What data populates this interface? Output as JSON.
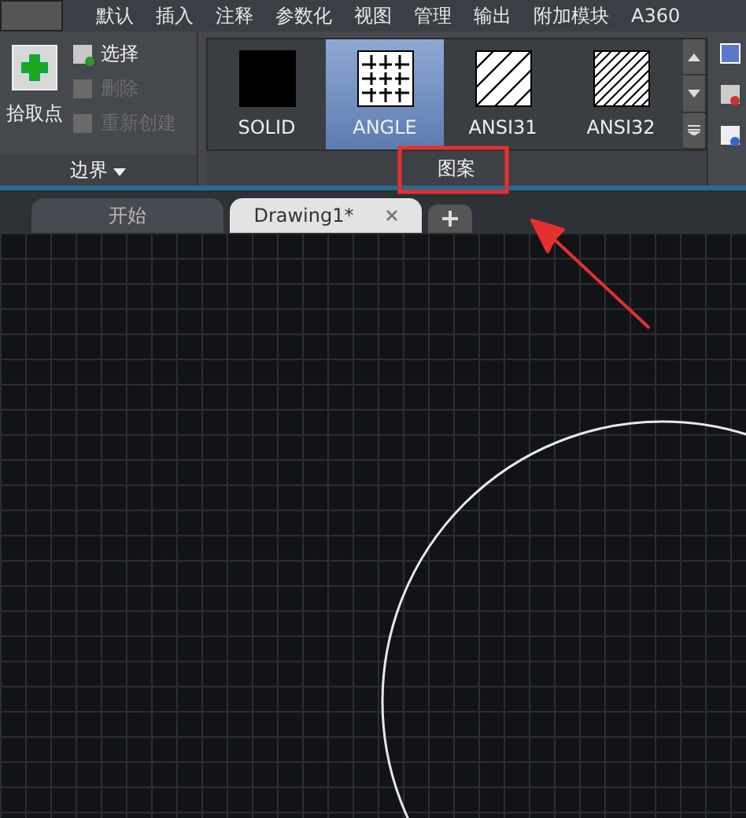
{
  "menu_tabs": [
    {
      "label": "默认",
      "selected": false
    },
    {
      "label": "插入",
      "selected": false
    },
    {
      "label": "注释",
      "selected": false
    },
    {
      "label": "参数化",
      "selected": false
    },
    {
      "label": "视图",
      "selected": false
    },
    {
      "label": "管理",
      "selected": false
    },
    {
      "label": "输出",
      "selected": false
    },
    {
      "label": "附加模块",
      "selected": false
    },
    {
      "label": "A360",
      "selected": false
    }
  ],
  "boundary_panel": {
    "pick_point": "拾取点",
    "items": [
      {
        "label": "选择",
        "disabled": false
      },
      {
        "label": "删除",
        "disabled": true
      },
      {
        "label": "重新创建",
        "disabled": true
      }
    ],
    "title": "边界"
  },
  "pattern_panel": {
    "patterns": [
      {
        "label": "SOLID",
        "kind": "solid",
        "selected": false
      },
      {
        "label": "ANGLE",
        "kind": "grid",
        "selected": true
      },
      {
        "label": "ANSI31",
        "kind": "hatch",
        "selected": false
      },
      {
        "label": "ANSI32",
        "kind": "dense",
        "selected": false
      }
    ],
    "title": "图案"
  },
  "doc_tabs": [
    {
      "label": "开始",
      "selected": false
    },
    {
      "label": "Drawing1*",
      "selected": true
    }
  ]
}
